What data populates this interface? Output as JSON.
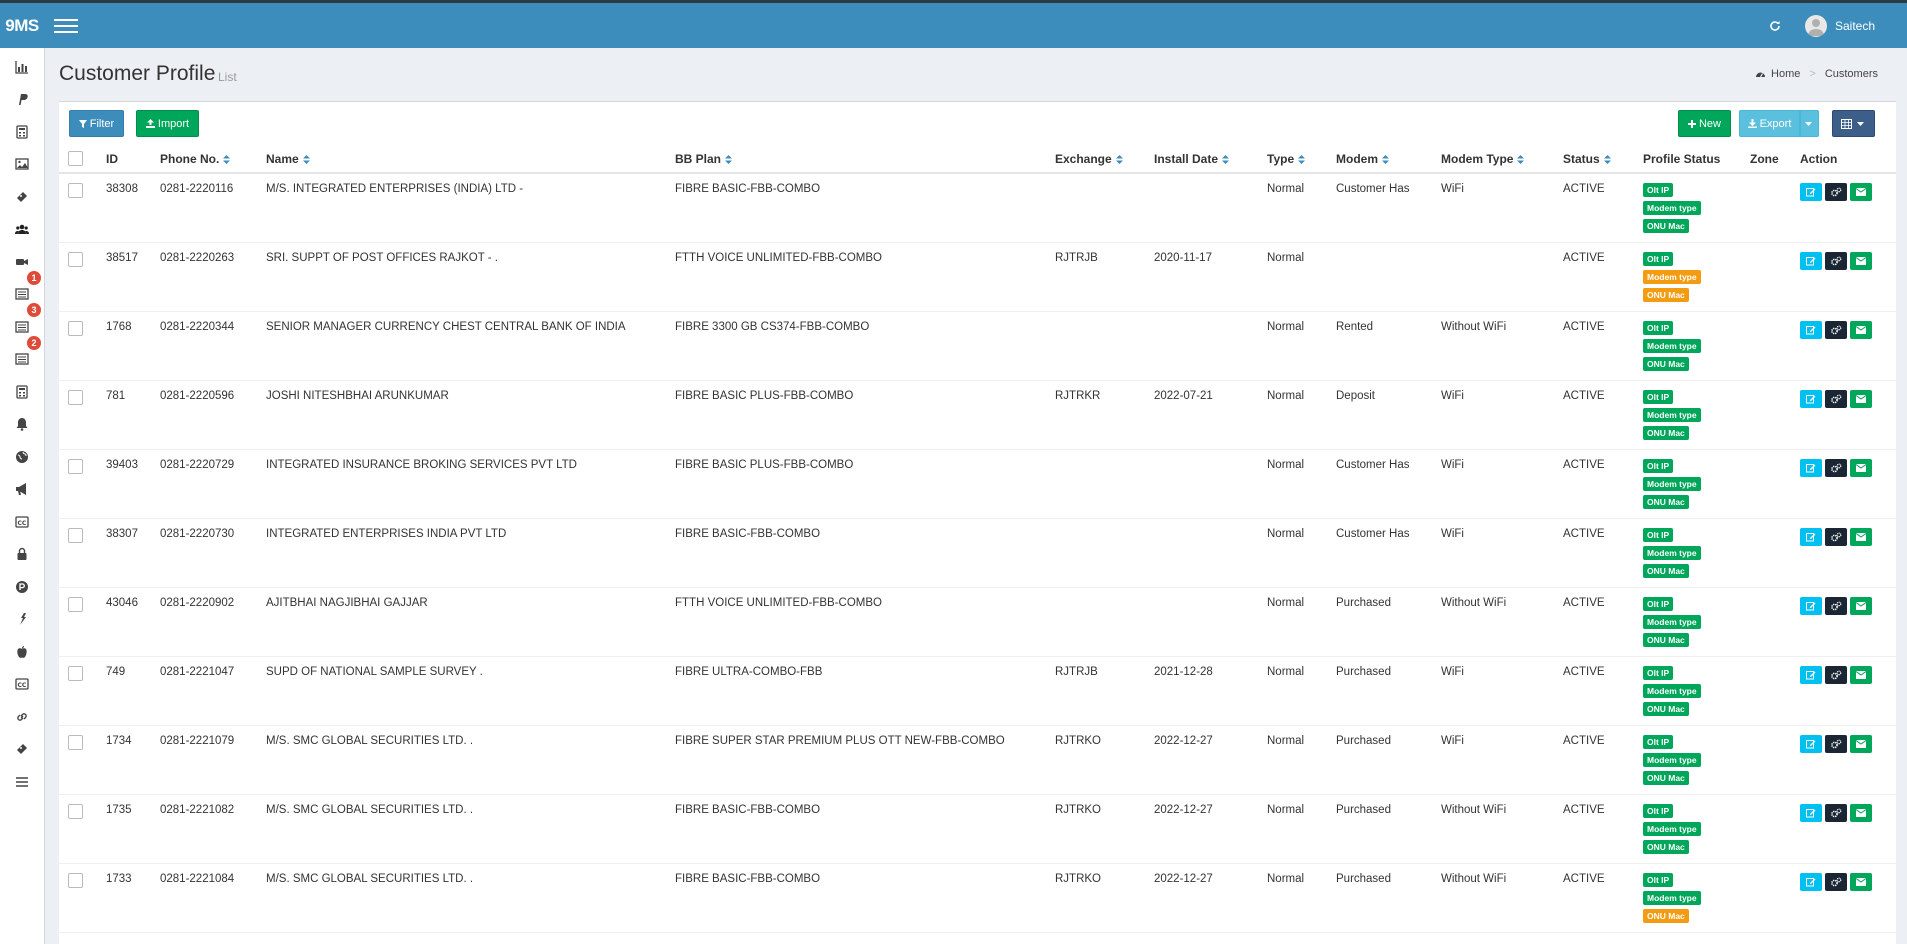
{
  "app": {
    "brand": "9MS",
    "username": "Saitech"
  },
  "page": {
    "title": "Customer Profile",
    "subtitle": "List"
  },
  "breadcrumb": {
    "home": "Home",
    "current": "Customers"
  },
  "toolbar": {
    "filter": "Filter",
    "import": "Import",
    "new": "New",
    "export": "Export"
  },
  "sidebar": {
    "badges": [
      "1",
      "3",
      "2"
    ]
  },
  "table": {
    "headers": {
      "id": "ID",
      "phone": "Phone No.",
      "name": "Name",
      "plan": "BB Plan",
      "exchange": "Exchange",
      "install": "Install Date",
      "type": "Type",
      "modem": "Modem",
      "modem_type": "Modem Type",
      "status": "Status",
      "profile_status": "Profile Status",
      "zone": "Zone",
      "action": "Action"
    },
    "tag_labels": {
      "olt": "Olt IP",
      "modem": "Modem type",
      "onu": "ONU Mac"
    },
    "rows": [
      {
        "id": "38308",
        "phone": "0281-2220116",
        "name": "M/S. INTEGRATED ENTERPRISES (INDIA) LTD -",
        "plan": "FIBRE BASIC-FBB-COMBO",
        "exchange": "",
        "install": "",
        "type": "Normal",
        "modem": "Customer Has",
        "modem_type": "WiFi",
        "status": "ACTIVE",
        "tags": [
          "green",
          "green",
          "green"
        ]
      },
      {
        "id": "38517",
        "phone": "0281-2220263",
        "name": "SRI. SUPPT OF POST OFFICES RAJKOT - .",
        "plan": "FTTH VOICE UNLIMITED-FBB-COMBO",
        "exchange": "RJTRJB",
        "install": "2020-11-17",
        "type": "Normal",
        "modem": "",
        "modem_type": "",
        "status": "ACTIVE",
        "tags": [
          "green",
          "orange",
          "orange"
        ]
      },
      {
        "id": "1768",
        "phone": "0281-2220344",
        "name": "SENIOR MANAGER CURRENCY CHEST CENTRAL BANK OF INDIA",
        "plan": "FIBRE 3300 GB CS374-FBB-COMBO",
        "exchange": "",
        "install": "",
        "type": "Normal",
        "modem": "Rented",
        "modem_type": "Without WiFi",
        "status": "ACTIVE",
        "tags": [
          "green",
          "green",
          "green"
        ]
      },
      {
        "id": "781",
        "phone": "0281-2220596",
        "name": "JOSHI NITESHBHAI ARUNKUMAR",
        "plan": "FIBRE BASIC PLUS-FBB-COMBO",
        "exchange": "RJTRKR",
        "install": "2022-07-21",
        "type": "Normal",
        "modem": "Deposit",
        "modem_type": "WiFi",
        "status": "ACTIVE",
        "tags": [
          "green",
          "green",
          "green"
        ]
      },
      {
        "id": "39403",
        "phone": "0281-2220729",
        "name": "INTEGRATED INSURANCE BROKING SERVICES PVT LTD",
        "plan": "FIBRE BASIC PLUS-FBB-COMBO",
        "exchange": "",
        "install": "",
        "type": "Normal",
        "modem": "Customer Has",
        "modem_type": "WiFi",
        "status": "ACTIVE",
        "tags": [
          "green",
          "green",
          "green"
        ]
      },
      {
        "id": "38307",
        "phone": "0281-2220730",
        "name": "INTEGRATED ENTERPRISES INDIA PVT LTD",
        "plan": "FIBRE BASIC-FBB-COMBO",
        "exchange": "",
        "install": "",
        "type": "Normal",
        "modem": "Customer Has",
        "modem_type": "WiFi",
        "status": "ACTIVE",
        "tags": [
          "green",
          "green",
          "green"
        ]
      },
      {
        "id": "43046",
        "phone": "0281-2220902",
        "name": "AJITBHAI NAGJIBHAI GAJJAR",
        "plan": "FTTH VOICE UNLIMITED-FBB-COMBO",
        "exchange": "",
        "install": "",
        "type": "Normal",
        "modem": "Purchased",
        "modem_type": "Without WiFi",
        "status": "ACTIVE",
        "tags": [
          "green",
          "green",
          "green"
        ]
      },
      {
        "id": "749",
        "phone": "0281-2221047",
        "name": "SUPD OF NATIONAL SAMPLE SURVEY .",
        "plan": "FIBRE ULTRA-COMBO-FBB",
        "exchange": "RJTRJB",
        "install": "2021-12-28",
        "type": "Normal",
        "modem": "Purchased",
        "modem_type": "WiFi",
        "status": "ACTIVE",
        "tags": [
          "green",
          "green",
          "green"
        ]
      },
      {
        "id": "1734",
        "phone": "0281-2221079",
        "name": "M/S. SMC GLOBAL SECURITIES LTD. .",
        "plan": "FIBRE SUPER STAR PREMIUM PLUS OTT NEW-FBB-COMBO",
        "exchange": "RJTRKO",
        "install": "2022-12-27",
        "type": "Normal",
        "modem": "Purchased",
        "modem_type": "WiFi",
        "status": "ACTIVE",
        "tags": [
          "green",
          "green",
          "green"
        ]
      },
      {
        "id": "1735",
        "phone": "0281-2221082",
        "name": "M/S. SMC GLOBAL SECURITIES LTD. .",
        "plan": "FIBRE BASIC-FBB-COMBO",
        "exchange": "RJTRKO",
        "install": "2022-12-27",
        "type": "Normal",
        "modem": "Purchased",
        "modem_type": "Without WiFi",
        "status": "ACTIVE",
        "tags": [
          "green",
          "green",
          "green"
        ]
      },
      {
        "id": "1733",
        "phone": "0281-2221084",
        "name": "M/S. SMC GLOBAL SECURITIES LTD. .",
        "plan": "FIBRE BASIC-FBB-COMBO",
        "exchange": "RJTRKO",
        "install": "2022-12-27",
        "type": "Normal",
        "modem": "Purchased",
        "modem_type": "Without WiFi",
        "status": "ACTIVE",
        "tags": [
          "green",
          "green",
          "orange"
        ]
      }
    ]
  },
  "colors": {
    "navbar": "#3c8dbc",
    "tag_green": "#00a65a",
    "tag_orange": "#f39c12",
    "badge": "#dd4b39"
  },
  "icons": {
    "sidebar": [
      "bar-chart-icon",
      "paypal-icon",
      "calculator-icon",
      "image-icon",
      "ticket-icon",
      "users-icon",
      "video-camera-icon",
      "list-icon",
      "list-icon",
      "list-icon",
      "calculator-icon",
      "bell-icon",
      "globe-icon",
      "bullhorn-icon",
      "cc-icon",
      "lock-icon",
      "product-hunt-icon",
      "plug-icon",
      "apple-icon",
      "cc-icon",
      "link-icon",
      "ticket-icon",
      "list-icon"
    ]
  }
}
